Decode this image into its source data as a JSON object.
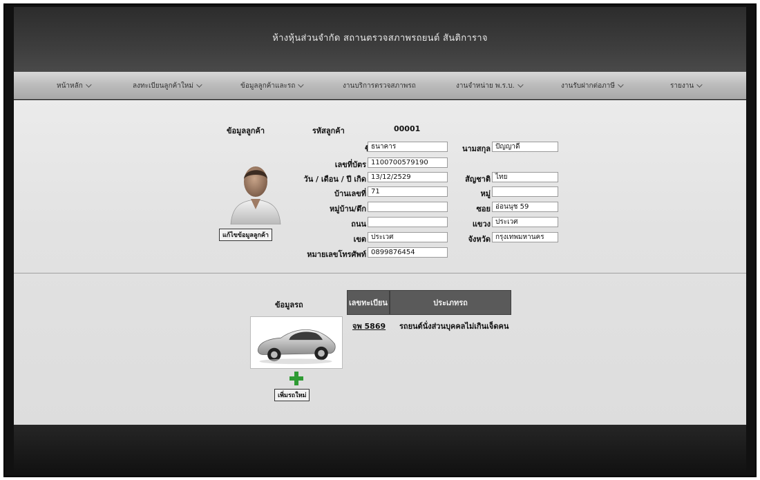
{
  "header": {
    "title": "ห้างหุ้นส่วนจำกัด สถานตรวจสภาพรถยนต์ สันติการาจ"
  },
  "nav": {
    "items": [
      {
        "label": "หน้าหลัก",
        "has_dropdown": true
      },
      {
        "label": "ลงทะเบียนลูกค้าใหม่",
        "has_dropdown": true
      },
      {
        "label": "ข้อมูลลูกค้าและรถ",
        "has_dropdown": true
      },
      {
        "label": "งานบริการตรวจสภาพรถ",
        "has_dropdown": false
      },
      {
        "label": "งานจำหน่าย พ.ร.บ.",
        "has_dropdown": true
      },
      {
        "label": "งานรับฝากต่อภาษี",
        "has_dropdown": true
      },
      {
        "label": "รายงาน",
        "has_dropdown": true
      }
    ]
  },
  "customer": {
    "section_label": "ข้อมูลลูกค้า",
    "code_label": "รหัสลูกค้า",
    "code_value": "00001",
    "edit_button": "แก้ไขข้อมูลลูกค้า",
    "fields": {
      "first_name": {
        "label": "ชื่อ",
        "value": "ธนาคาร"
      },
      "last_name": {
        "label": "นามสกุล",
        "value": "ปัญญาดี"
      },
      "id_card": {
        "label": "เลขที่บัตร",
        "value": "1100700579190"
      },
      "birthdate": {
        "label": "วัน / เดือน / ปี เกิด",
        "value": "13/12/2529"
      },
      "nationality": {
        "label": "สัญชาติ",
        "value": "ไทย"
      },
      "house_no": {
        "label": "บ้านเลขที่",
        "value": "71"
      },
      "moo": {
        "label": "หมู่",
        "value": ""
      },
      "village": {
        "label": "หมู่บ้าน/ตึก",
        "value": ""
      },
      "soi": {
        "label": "ซอย",
        "value": "อ่อนนุช 59"
      },
      "road": {
        "label": "ถนน",
        "value": ""
      },
      "subdistrict": {
        "label": "แขวง",
        "value": "ประเวศ"
      },
      "district": {
        "label": "เขต",
        "value": "ประเวศ"
      },
      "province": {
        "label": "จังหวัด",
        "value": "กรุงเทพมหานคร"
      },
      "phone": {
        "label": "หมายเลขโทรศัพท์",
        "value": "0899876454"
      }
    }
  },
  "vehicle": {
    "section_label": "ข้อมูลรถ",
    "columns": [
      "เลขทะเบียน",
      "ประเภทรถ"
    ],
    "rows": [
      {
        "plate": "จพ 5869",
        "type": "รถยนต์นั่งส่วนบุคคลไม่เกินเจ็ดคน"
      }
    ],
    "add_button": "เพิ่มรถใหม่"
  },
  "colors": {
    "header_bg": "#333333",
    "nav_bg": "#bdbdbd",
    "table_head_bg": "#5a5a5a",
    "add_icon": "#2f9b34"
  },
  "icons": {
    "avatar": "user-avatar-icon",
    "car": "car-image",
    "add": "plus-icon"
  }
}
